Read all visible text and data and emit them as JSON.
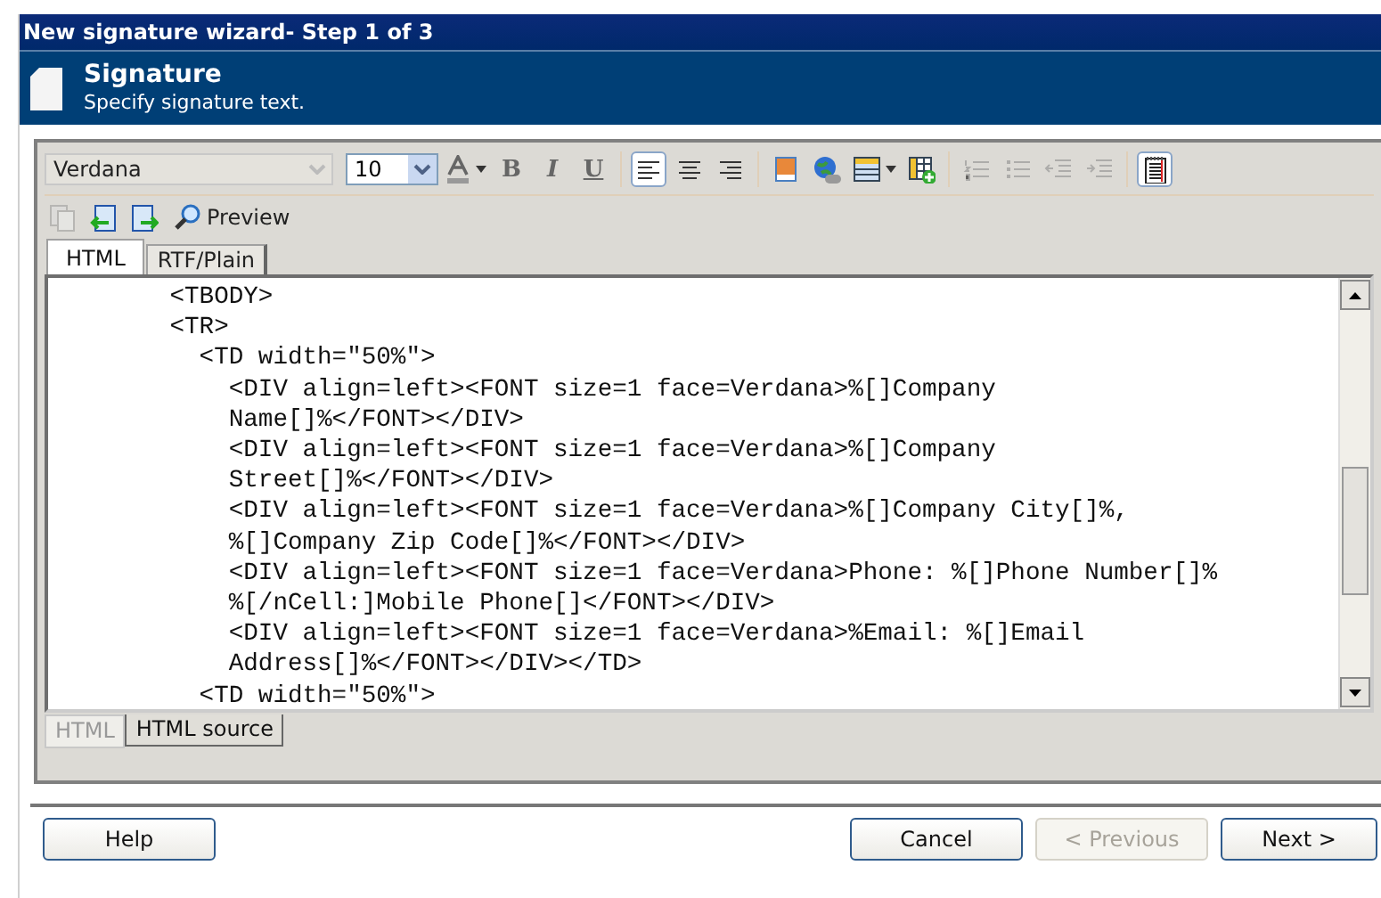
{
  "window": {
    "title": "New signature wizard- Step 1 of 3"
  },
  "header": {
    "title": "Signature",
    "subtitle": "Specify signature text."
  },
  "toolbar": {
    "font": {
      "value": "Verdana",
      "disabled": true
    },
    "size": {
      "value": "10",
      "disabled": false
    },
    "buttons": [
      {
        "kind": "font-color",
        "selected": false,
        "disabled": false
      },
      {
        "kind": "bold",
        "label": "B",
        "selected": false,
        "disabled": false
      },
      {
        "kind": "italic",
        "label": "I",
        "selected": false,
        "disabled": false
      },
      {
        "kind": "underline",
        "label": "U",
        "selected": false,
        "disabled": false
      },
      {
        "kind": "align-left",
        "selected": true,
        "disabled": false
      },
      {
        "kind": "align-center",
        "selected": false,
        "disabled": false
      },
      {
        "kind": "align-right",
        "selected": false,
        "disabled": false
      },
      {
        "kind": "image",
        "selected": false,
        "disabled": false
      },
      {
        "kind": "link",
        "selected": false,
        "disabled": false
      },
      {
        "kind": "table",
        "selected": false,
        "disabled": false
      },
      {
        "kind": "insert-table",
        "selected": false,
        "disabled": false
      },
      {
        "kind": "ordered-list",
        "selected": false,
        "disabled": true
      },
      {
        "kind": "bullet-list",
        "selected": false,
        "disabled": true
      },
      {
        "kind": "outdent",
        "selected": false,
        "disabled": true
      },
      {
        "kind": "indent",
        "selected": false,
        "disabled": true
      },
      {
        "kind": "source",
        "selected": true,
        "disabled": false
      }
    ],
    "actions": [
      {
        "kind": "copy",
        "disabled": true
      },
      {
        "kind": "import",
        "disabled": false
      },
      {
        "kind": "export",
        "disabled": false
      },
      {
        "kind": "preview",
        "label": "Preview",
        "disabled": false
      }
    ]
  },
  "format_tabs": [
    {
      "label": "HTML",
      "selected": true
    },
    {
      "label": "RTF/Plain",
      "selected": false
    }
  ],
  "source_lines": [
    "        <TBODY>",
    "        <TR>",
    "          <TD width=\"50%\">",
    "            <DIV align=left><FONT size=1 face=Verdana>%[]Company",
    "            Name[]%</FONT></DIV>",
    "            <DIV align=left><FONT size=1 face=Verdana>%[]Company",
    "            Street[]%</FONT></DIV>",
    "            <DIV align=left><FONT size=1 face=Verdana>%[]Company City[]%,",
    "            %[]Company Zip Code[]%</FONT></DIV>",
    "            <DIV align=left><FONT size=1 face=Verdana>Phone: %[]Phone Number[]%",
    "            %[/nCell:]Mobile Phone[]</FONT></DIV>",
    "            <DIV align=left><FONT size=1 face=Verdana>%Email: %[]Email",
    "            Address[]%</FONT></DIV></TD>",
    "          <TD width=\"50%\">"
  ],
  "view_tabs": [
    {
      "label": "HTML",
      "selected": false
    },
    {
      "label": "HTML source",
      "selected": true
    }
  ],
  "buttons": [
    {
      "kind": "help",
      "label": "Help",
      "disabled": false
    },
    {
      "kind": "cancel",
      "label": "Cancel",
      "disabled": false
    },
    {
      "kind": "previous",
      "label": "< Previous",
      "disabled": true
    },
    {
      "kind": "next",
      "label": "Next >",
      "disabled": false
    }
  ]
}
